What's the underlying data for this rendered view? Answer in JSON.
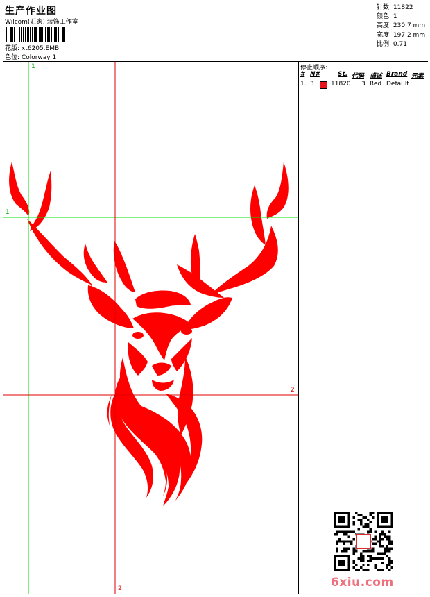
{
  "header": {
    "title": "生产作业图",
    "subtitle": "Wilcom(汇家) 装饰工作室",
    "design_label": "花版:",
    "design_value": "xt6205.EMB",
    "colorway_label": "色位:",
    "colorway_value": "Colorway 1"
  },
  "stats": [
    {
      "label": "针数:",
      "value": "11822"
    },
    {
      "label": "颜色:",
      "value": "1"
    },
    {
      "label": "高度:",
      "value": "230.7 mm"
    },
    {
      "label": "宽度:",
      "value": "197.2 mm"
    },
    {
      "label": "比例:",
      "value": "0.71"
    }
  ],
  "sequence": {
    "title": "停止顺序:",
    "columns": [
      "#",
      "N#",
      "St.",
      "代码",
      "描述",
      "Brand",
      "元素"
    ],
    "rows": [
      {
        "index": "1.",
        "needle": "3",
        "swatch_color": "#e8141b",
        "stitches": "11820",
        "code": "3",
        "description": "Red",
        "brand": "Default"
      }
    ]
  },
  "guides": {
    "v1": "1",
    "h1": "1",
    "h2": "2",
    "v2": "2"
  },
  "colors": {
    "design": "#ff0000",
    "guide_green": "#00dd00",
    "guide_red": "#e00000"
  },
  "watermark": "6xiu.com"
}
